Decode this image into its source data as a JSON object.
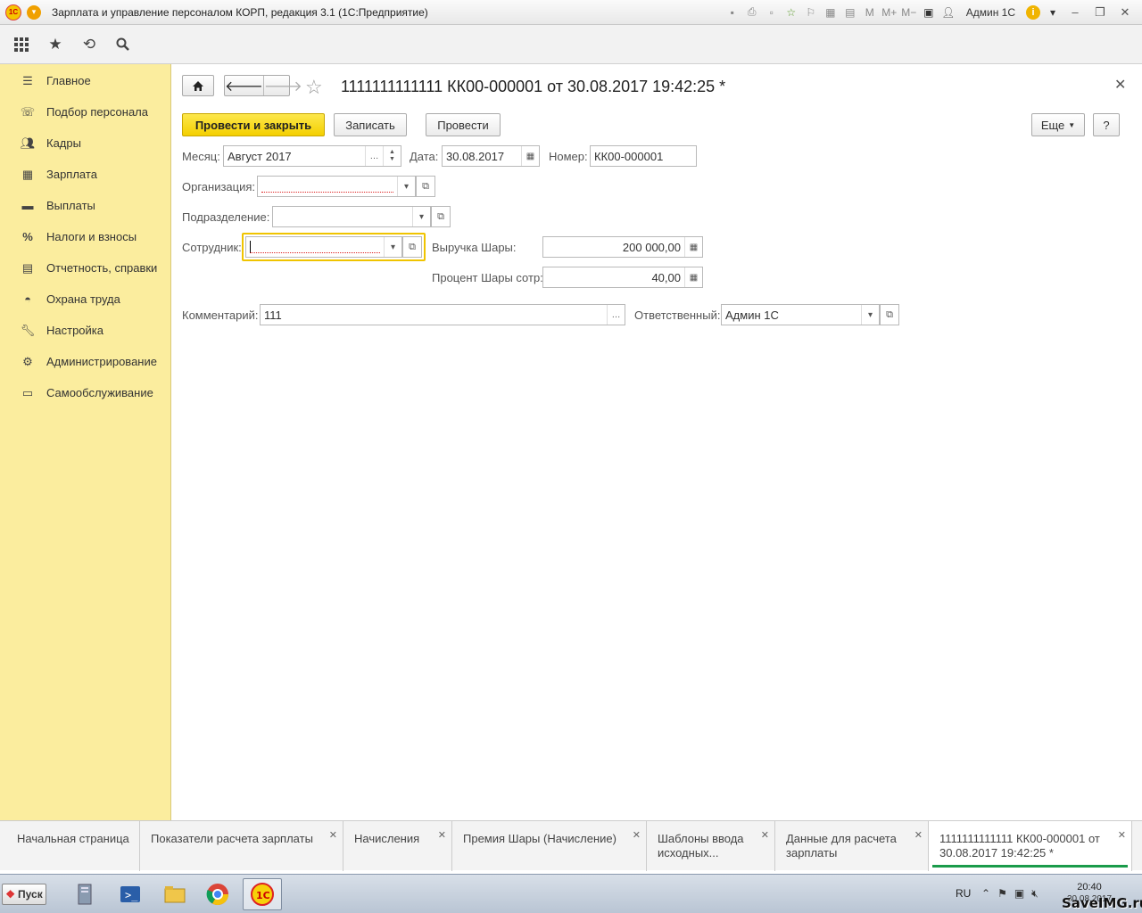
{
  "window": {
    "title": "Зарплата и управление персоналом КОРП, редакция 3.1  (1С:Предприятие)",
    "user": "Админ 1С"
  },
  "sidebar": {
    "items": [
      {
        "label": "Главное",
        "icon": "menu-lines-icon"
      },
      {
        "label": "Подбор персонала",
        "icon": "phone-icon"
      },
      {
        "label": "Кадры",
        "icon": "people-icon"
      },
      {
        "label": "Зарплата",
        "icon": "calculator-icon"
      },
      {
        "label": "Выплаты",
        "icon": "card-icon"
      },
      {
        "label": "Налоги и взносы",
        "icon": "percent-icon"
      },
      {
        "label": "Отчетность, справки",
        "icon": "report-icon"
      },
      {
        "label": "Охрана труда",
        "icon": "helmet-icon"
      },
      {
        "label": "Настройка",
        "icon": "wrench-icon"
      },
      {
        "label": "Администрирование",
        "icon": "gear-icon"
      },
      {
        "label": "Самообслуживание",
        "icon": "id-card-icon"
      }
    ]
  },
  "document": {
    "title": "1111111111111 КК00-000001 от 30.08.2017 19:42:25 *"
  },
  "toolbar": {
    "post_close": "Провести и закрыть",
    "save": "Записать",
    "post": "Провести",
    "more": "Еще",
    "help": "?"
  },
  "form": {
    "month_label": "Месяц:",
    "month_value": "Август 2017",
    "date_label": "Дата:",
    "date_value": "30.08.2017",
    "number_label": "Номер:",
    "number_value": "КК00-000001",
    "org_label": "Организация:",
    "org_value": "",
    "dept_label": "Подразделение:",
    "dept_value": "",
    "employee_label": "Сотрудник:",
    "employee_value": "",
    "revenue_label": "Выручка Шары:",
    "revenue_value": "200 000,00",
    "percent_label": "Процент Шары сотр:",
    "percent_value": "40,00",
    "comment_label": "Комментарий:",
    "comment_value": "111",
    "responsible_label": "Ответственный:",
    "responsible_value": "Админ 1С"
  },
  "tabs": [
    {
      "label": "Начальная страница",
      "closable": false
    },
    {
      "label": "Показатели расчета зарплаты",
      "closable": true
    },
    {
      "label": "Начисления",
      "closable": true
    },
    {
      "label": "Премия Шары (Начисление)",
      "closable": true
    },
    {
      "label": "Шаблоны ввода исходных...",
      "closable": true
    },
    {
      "label": "Данные для расчета зарплаты",
      "closable": true
    },
    {
      "label": "1111111111111 КК00-000001 от 30.08.2017 19:42:25 *",
      "closable": true,
      "active": true
    }
  ],
  "taskbar": {
    "start": "Пуск",
    "lang": "RU",
    "time": "20:40",
    "date": "30.08.2017"
  },
  "watermark": "SaveIMG.ru",
  "colors": {
    "sidebar_bg": "#fbed9e",
    "primary_button": "#f4cf00",
    "active_tab_line": "#1a9b4a",
    "focus_border": "#f0c400"
  }
}
